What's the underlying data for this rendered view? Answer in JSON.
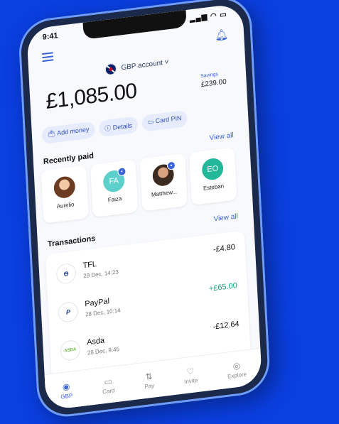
{
  "status": {
    "time": "9:41",
    "icons": "▂▄▆ ◠ ▭"
  },
  "header": {
    "account_label": "GBP account ˅"
  },
  "balance": {
    "amount": "£1,085.00"
  },
  "savings": {
    "label": "Savings",
    "value": "£239.00"
  },
  "actions": [
    "Add money",
    "Details",
    "Card PIN"
  ],
  "recently_paid": {
    "title": "Recently paid",
    "view_all": "View all",
    "items": [
      {
        "name": "Aurelio",
        "initials": ""
      },
      {
        "name": "Faiza",
        "initials": "FA"
      },
      {
        "name": "Matthew...",
        "initials": ""
      },
      {
        "name": "Esteban",
        "initials": "EO"
      }
    ]
  },
  "transactions": {
    "title": "Transactions",
    "view_all": "View all",
    "items": [
      {
        "name": "TFL",
        "date": "29 Dec, 14:23",
        "amount": "-£4.80",
        "logo": "⊖"
      },
      {
        "name": "PayPal",
        "date": "28 Dec, 10:14",
        "amount": "+£65.00",
        "logo": "P"
      },
      {
        "name": "Asda",
        "date": "28 Dec, 9:45",
        "amount": "-£12.64",
        "logo": "ASDA"
      }
    ]
  },
  "tabbar": [
    "GBP",
    "Card",
    "Pay",
    "Invite",
    "Explore"
  ],
  "colors": {
    "background": "#0a3fe0",
    "accent": "#3a63d6",
    "positive": "#1aa67a"
  }
}
